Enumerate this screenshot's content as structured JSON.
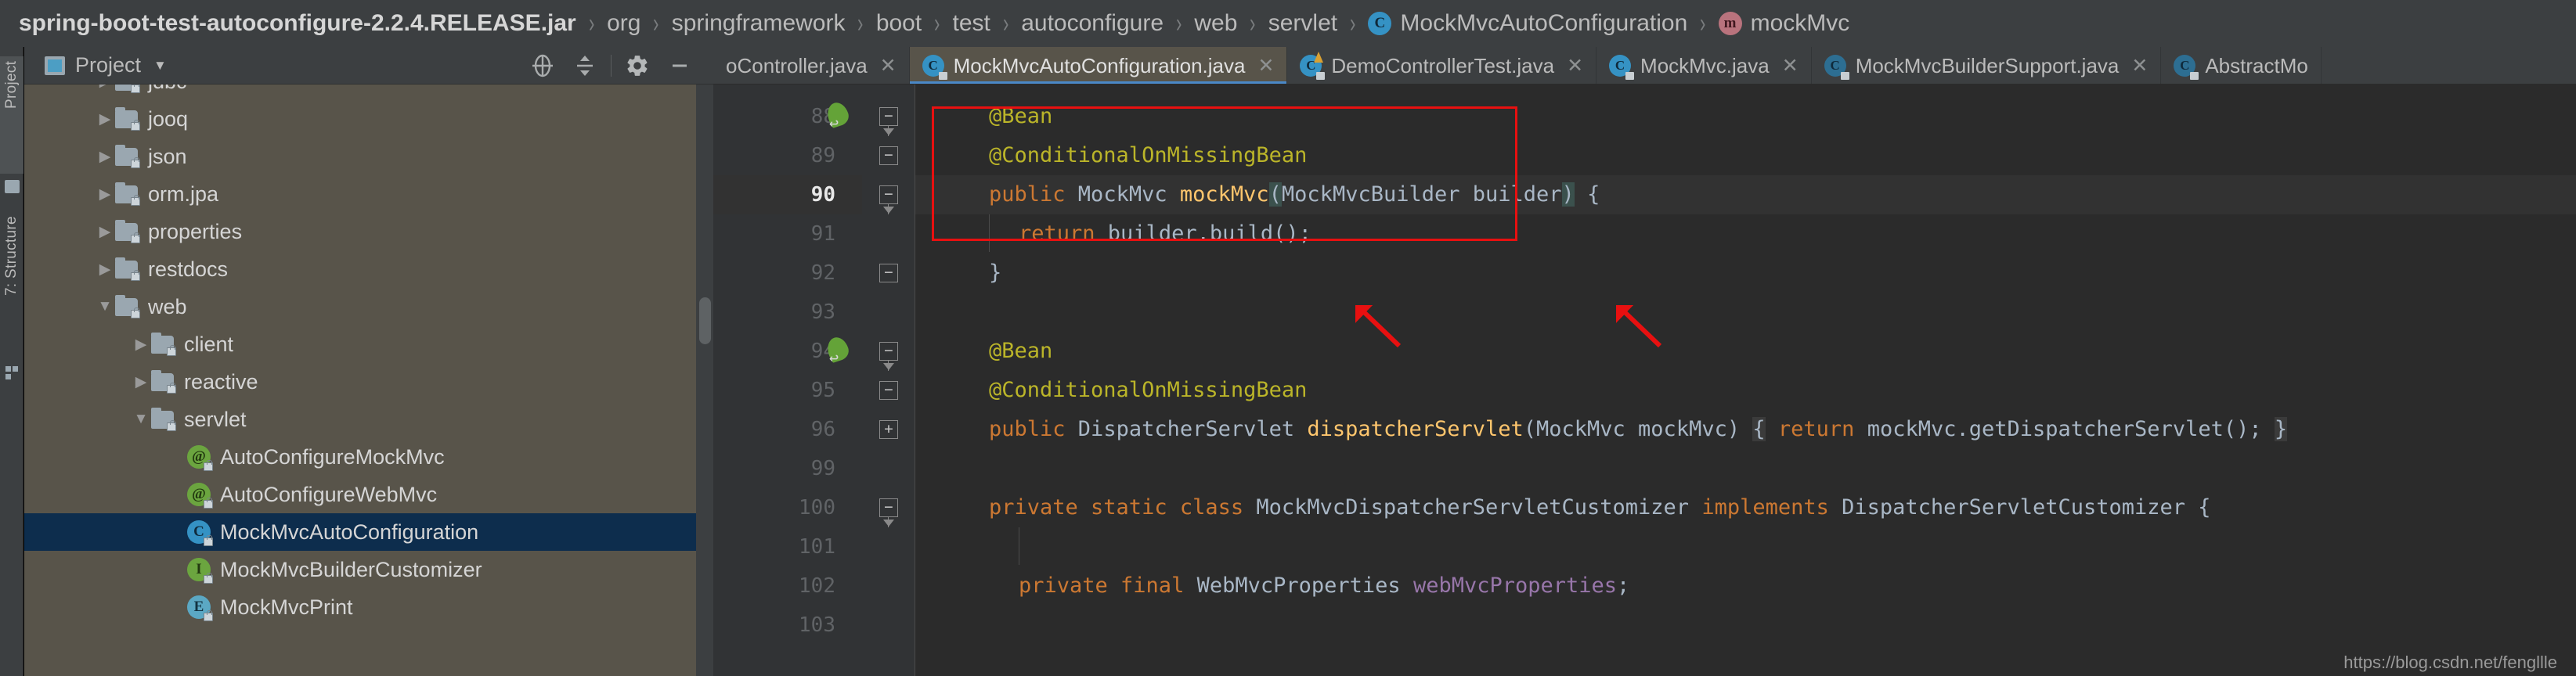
{
  "breadcrumb": {
    "items": [
      {
        "label": "spring-boot-test-autoconfigure-2.2.4.RELEASE.jar",
        "icon": "none"
      },
      {
        "label": "org",
        "icon": "none"
      },
      {
        "label": "springframework",
        "icon": "none"
      },
      {
        "label": "boot",
        "icon": "none"
      },
      {
        "label": "test",
        "icon": "none"
      },
      {
        "label": "autoconfigure",
        "icon": "none"
      },
      {
        "label": "web",
        "icon": "none"
      },
      {
        "label": "servlet",
        "icon": "none"
      },
      {
        "label": "MockMvcAutoConfiguration",
        "icon": "class-icon",
        "icon_letter": "C"
      },
      {
        "label": "mockMvc",
        "icon": "method-icon",
        "icon_letter": "m"
      }
    ],
    "separator": "›"
  },
  "tool_window_bar": {
    "buttons": [
      {
        "label": "Project",
        "icon": "project-folder-icon",
        "active": true
      },
      {
        "label": "7: Structure",
        "icon": "structure-icon",
        "active": false
      }
    ]
  },
  "project_panel": {
    "title": "Project",
    "caret": "▼",
    "actions": [
      {
        "name": "locate-icon",
        "glyph": "⊕"
      },
      {
        "name": "collapse-all-icon",
        "glyph": "≡"
      },
      {
        "name": "settings-gear-icon",
        "glyph": "⚙"
      },
      {
        "name": "hide-icon",
        "glyph": "—"
      }
    ],
    "tree": [
      {
        "label": "jdbc",
        "type": "folder",
        "arrow": "▶",
        "indent": 0,
        "selected": false,
        "clipped": true
      },
      {
        "label": "jooq",
        "type": "folder",
        "arrow": "▶",
        "indent": 0,
        "selected": false
      },
      {
        "label": "json",
        "type": "folder",
        "arrow": "▶",
        "indent": 0,
        "selected": false
      },
      {
        "label": "orm.jpa",
        "type": "folder",
        "arrow": "▶",
        "indent": 0,
        "selected": false
      },
      {
        "label": "properties",
        "type": "folder",
        "arrow": "▶",
        "indent": 0,
        "selected": false
      },
      {
        "label": "restdocs",
        "type": "folder",
        "arrow": "▶",
        "indent": 0,
        "selected": false
      },
      {
        "label": "web",
        "type": "folder",
        "arrow": "▼",
        "indent": 0,
        "selected": false
      },
      {
        "label": "client",
        "type": "folder",
        "arrow": "▶",
        "indent": 1,
        "selected": false
      },
      {
        "label": "reactive",
        "type": "folder",
        "arrow": "▶",
        "indent": 1,
        "selected": false
      },
      {
        "label": "servlet",
        "type": "folder",
        "arrow": "▼",
        "indent": 1,
        "selected": false
      },
      {
        "label": "AutoConfigureMockMvc",
        "type": "annotation",
        "badge": "@",
        "arrow": "",
        "indent": 2,
        "selected": false
      },
      {
        "label": "AutoConfigureWebMvc",
        "type": "annotation",
        "badge": "@",
        "arrow": "",
        "indent": 2,
        "selected": false
      },
      {
        "label": "MockMvcAutoConfiguration",
        "type": "class",
        "badge": "C",
        "arrow": "",
        "indent": 2,
        "selected": true
      },
      {
        "label": "MockMvcBuilderCustomizer",
        "type": "interface",
        "badge": "I",
        "arrow": "",
        "indent": 2,
        "selected": false
      },
      {
        "label": "MockMvcPrint",
        "type": "enum",
        "badge": "E",
        "arrow": "",
        "indent": 2,
        "selected": false
      }
    ]
  },
  "editor_tabs": [
    {
      "label": "oController.java",
      "icon": "class-icon",
      "icon_letter": "C",
      "active": false,
      "clipped": true,
      "close": "✕"
    },
    {
      "label": "MockMvcAutoConfiguration.java",
      "icon": "class-icon",
      "icon_letter": "C",
      "active": true,
      "close": "✕"
    },
    {
      "label": "DemoControllerTest.java",
      "icon": "test-class-icon",
      "icon_letter": "C",
      "active": false,
      "close": "✕"
    },
    {
      "label": "MockMvc.java",
      "icon": "class-icon",
      "icon_letter": "C",
      "active": false,
      "close": "✕"
    },
    {
      "label": "MockMvcBuilderSupport.java",
      "icon": "class-icon",
      "icon_letter": "C",
      "active": false,
      "close": "✕"
    },
    {
      "label": "AbstractMo",
      "icon": "class-icon",
      "icon_letter": "C",
      "active": false,
      "clipped": true,
      "close": ""
    }
  ],
  "editor": {
    "current_line": 90,
    "line_numbers": [
      88,
      89,
      90,
      91,
      92,
      93,
      94,
      95,
      96,
      99,
      100,
      101,
      102,
      103
    ],
    "gutter_bean_icons": [
      88,
      94
    ],
    "lines": [
      {
        "num": 88,
        "indent": 1,
        "tokens": [
          {
            "t": "@Bean",
            "c": "ann"
          }
        ]
      },
      {
        "num": 89,
        "indent": 1,
        "tokens": [
          {
            "t": "@ConditionalOnMissingBean",
            "c": "ann"
          }
        ]
      },
      {
        "num": 90,
        "indent": 1,
        "tokens": [
          {
            "t": "public",
            "c": "k"
          },
          {
            "t": " MockMvc ",
            "c": "p"
          },
          {
            "t": "mockMvc",
            "c": "mname"
          },
          {
            "t": "(",
            "c": "match"
          },
          {
            "t": "MockMvcBuilder builder",
            "c": "p"
          },
          {
            "t": ")",
            "c": "match"
          },
          {
            "t": " {",
            "c": "p"
          }
        ]
      },
      {
        "num": 91,
        "indent": 2,
        "tokens": [
          {
            "t": "return",
            "c": "k"
          },
          {
            "t": " builder.build();",
            "c": "p"
          }
        ]
      },
      {
        "num": 92,
        "indent": 1,
        "tokens": [
          {
            "t": "}",
            "c": "p"
          }
        ]
      },
      {
        "num": 93,
        "indent": 0,
        "tokens": []
      },
      {
        "num": 94,
        "indent": 1,
        "tokens": [
          {
            "t": "@Bean",
            "c": "ann"
          }
        ]
      },
      {
        "num": 95,
        "indent": 1,
        "tokens": [
          {
            "t": "@ConditionalOnMissingBean",
            "c": "ann"
          }
        ]
      },
      {
        "num": 96,
        "indent": 1,
        "tokens": [
          {
            "t": "public",
            "c": "k"
          },
          {
            "t": " DispatcherServlet ",
            "c": "p"
          },
          {
            "t": "dispatcherServlet",
            "c": "mname"
          },
          {
            "t": "(MockMvc mockMvc)",
            "c": "p"
          },
          {
            "t": " ",
            "c": "p"
          },
          {
            "t": "{",
            "c": "folded"
          },
          {
            "t": " ",
            "c": "p"
          },
          {
            "t": "return",
            "c": "k"
          },
          {
            "t": " mockMvc.getDispatcherServlet();",
            "c": "p"
          },
          {
            "t": " ",
            "c": "p"
          },
          {
            "t": "}",
            "c": "folded"
          }
        ]
      },
      {
        "num": 99,
        "indent": 0,
        "tokens": []
      },
      {
        "num": 100,
        "indent": 1,
        "tokens": [
          {
            "t": "private static class",
            "c": "k"
          },
          {
            "t": " MockMvcDispatcherServletCustomizer ",
            "c": "p"
          },
          {
            "t": "implements",
            "c": "k"
          },
          {
            "t": " DispatcherServletCustomizer {",
            "c": "p"
          }
        ]
      },
      {
        "num": 101,
        "indent": 0,
        "tokens": []
      },
      {
        "num": 102,
        "indent": 2,
        "tokens": [
          {
            "t": "private final",
            "c": "k"
          },
          {
            "t": " WebMvcProperties ",
            "c": "p"
          },
          {
            "t": "webMvcProperties",
            "c": "fld"
          },
          {
            "t": ";",
            "c": "p"
          }
        ]
      },
      {
        "num": 103,
        "indent": 0,
        "tokens": []
      }
    ],
    "fold_markers": [
      {
        "num": 88,
        "glyph": "−",
        "kind": "start"
      },
      {
        "num": 89,
        "glyph": "−",
        "kind": "mid"
      },
      {
        "num": 90,
        "glyph": "−",
        "kind": "start"
      },
      {
        "num": 92,
        "glyph": "−",
        "kind": "end"
      },
      {
        "num": 94,
        "glyph": "−",
        "kind": "start"
      },
      {
        "num": 95,
        "glyph": "−",
        "kind": "mid"
      },
      {
        "num": 96,
        "glyph": "+",
        "kind": "collapsed"
      },
      {
        "num": 100,
        "glyph": "−",
        "kind": "start"
      }
    ],
    "annotations": {
      "rect_label": "red-highlight-box",
      "arrows": [
        "arrow-to-dispatcherservlet-type",
        "arrow-to-mockmvc-param"
      ]
    }
  },
  "watermark": "https://blog.csdn.net/fengllle",
  "colors": {
    "breadcrumb_bg": "#3c3f41",
    "tree_bg": "#58544a",
    "tree_selected": "#0d2d4d",
    "editor_bg": "#2b2b2b",
    "gutter_bg": "#313335",
    "accent_tab_underline": "#4a88c7",
    "annotation_red": "#e81010",
    "keyword_orange": "#cc7832",
    "annotation_yellow": "#bbb529",
    "method_yellow": "#ffc66d",
    "field_purple": "#9876aa",
    "text_default": "#a9b7c6"
  }
}
